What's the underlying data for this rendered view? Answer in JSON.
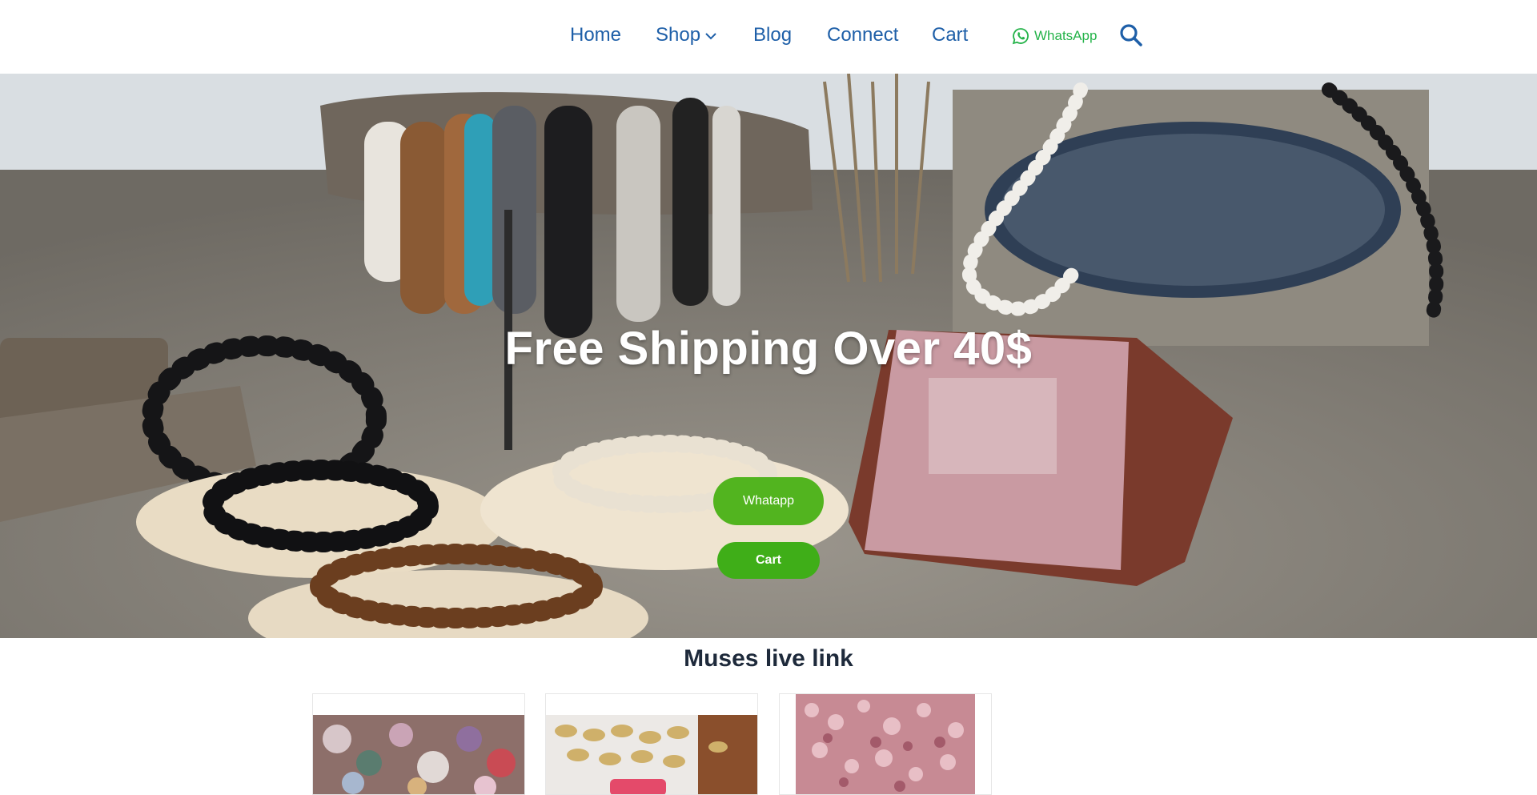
{
  "nav": {
    "home": "Home",
    "shop": "Shop",
    "blog": "Blog",
    "connect": "Connect",
    "cart": "Cart",
    "whatsapp": "WhatsApp"
  },
  "hero": {
    "title": "Free Shipping Over 40$",
    "whatsapp_button": "Whatapp",
    "cart_button": "Cart"
  },
  "section": {
    "title": "Muses live link"
  },
  "icons": {
    "dropdown": "chevron-down-icon",
    "whatsapp": "whatsapp-icon",
    "search": "search-icon"
  },
  "colors": {
    "nav_link": "#1e5fa8",
    "whatsapp_text": "#25b34a",
    "button_green": "#52b41f",
    "section_title": "#1e2a3b"
  }
}
